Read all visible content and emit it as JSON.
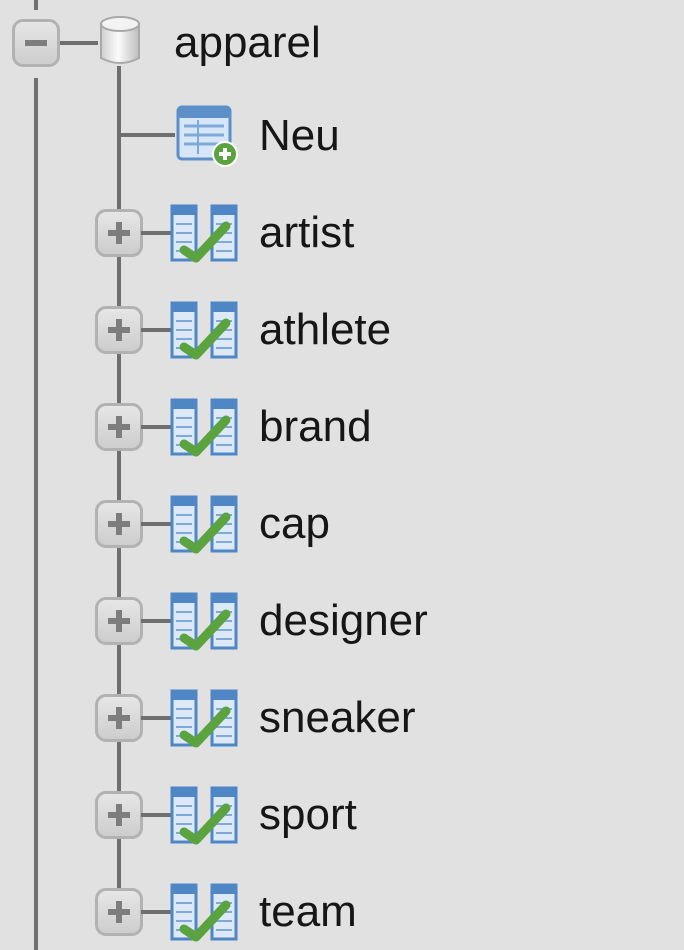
{
  "tree": {
    "database": {
      "name": "apparel",
      "icon": "database-icon",
      "expanded": true,
      "toggle_icon": "collapse-minus-icon"
    },
    "new_item": {
      "label": "Neu",
      "icon": "new-table-icon"
    },
    "tables": [
      {
        "name": "artist",
        "icon": "view-icon",
        "toggle_icon": "expand-plus-icon"
      },
      {
        "name": "athlete",
        "icon": "view-icon",
        "toggle_icon": "expand-plus-icon"
      },
      {
        "name": "brand",
        "icon": "view-icon",
        "toggle_icon": "expand-plus-icon"
      },
      {
        "name": "cap",
        "icon": "view-icon",
        "toggle_icon": "expand-plus-icon"
      },
      {
        "name": "designer",
        "icon": "view-icon",
        "toggle_icon": "expand-plus-icon"
      },
      {
        "name": "sneaker",
        "icon": "view-icon",
        "toggle_icon": "expand-plus-icon"
      },
      {
        "name": "sport",
        "icon": "view-icon",
        "toggle_icon": "expand-plus-icon"
      },
      {
        "name": "team",
        "icon": "view-icon",
        "toggle_icon": "expand-plus-icon"
      }
    ]
  },
  "colors": {
    "background": "#e1e1e1",
    "connector": "#6f6f6f",
    "text": "#161616",
    "view_check": "#5aa33f",
    "icon_blue": "#4f86c6"
  }
}
